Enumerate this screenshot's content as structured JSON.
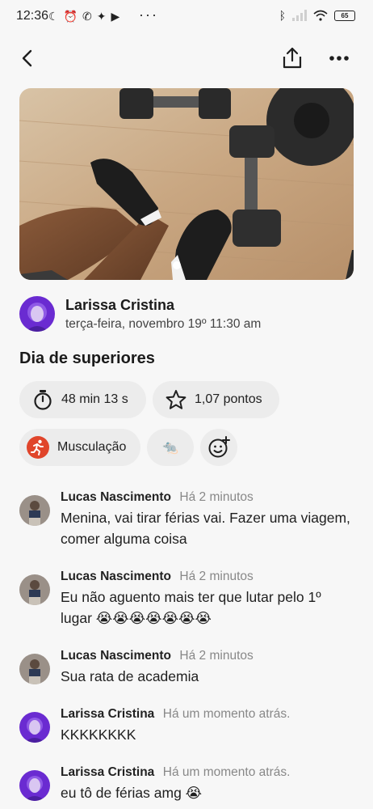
{
  "status_bar": {
    "time": "12:36",
    "dots": "···",
    "battery": "65"
  },
  "post": {
    "author_name": "Larissa Cristina",
    "date": "terça-feira, novembro 19º 11:30 am",
    "title": "Dia de superiores",
    "duration": "48 min 13 s",
    "points": "1,07 pontos",
    "activity": "Musculação",
    "reaction_emoji": "🐀"
  },
  "comments": [
    {
      "name": "Lucas Nascimento",
      "time": "Há 2 minutos",
      "text": "Menina, vai tirar férias vai. Fazer uma viagem, comer alguma coisa"
    },
    {
      "name": "Lucas Nascimento",
      "time": "Há 2 minutos",
      "text": "Eu não aguento mais ter que lutar pelo 1º lugar 😭😭😭😭😭😭😭"
    },
    {
      "name": "Lucas Nascimento",
      "time": "Há 2 minutos",
      "text": "Sua rata de academia"
    },
    {
      "name": "Larissa Cristina",
      "time": "Há um momento atrás.",
      "text": "KKKKKKKK"
    },
    {
      "name": "Larissa Cristina",
      "time": "Há um momento atrás.",
      "text": "eu tô de férias amg 😭"
    }
  ],
  "colors": {
    "background": "#f7f7f7",
    "chip": "#ececec",
    "activity_icon": "#e0452b",
    "avatar_larissa": "#6a2bd1"
  },
  "icons": {
    "back": "chevron-left-icon",
    "share": "share-icon",
    "more": "more-horizontal-icon",
    "duration": "stopwatch-icon",
    "points": "star-outline-icon",
    "activity": "running-person-icon",
    "add_reaction": "add-emoji-icon"
  }
}
